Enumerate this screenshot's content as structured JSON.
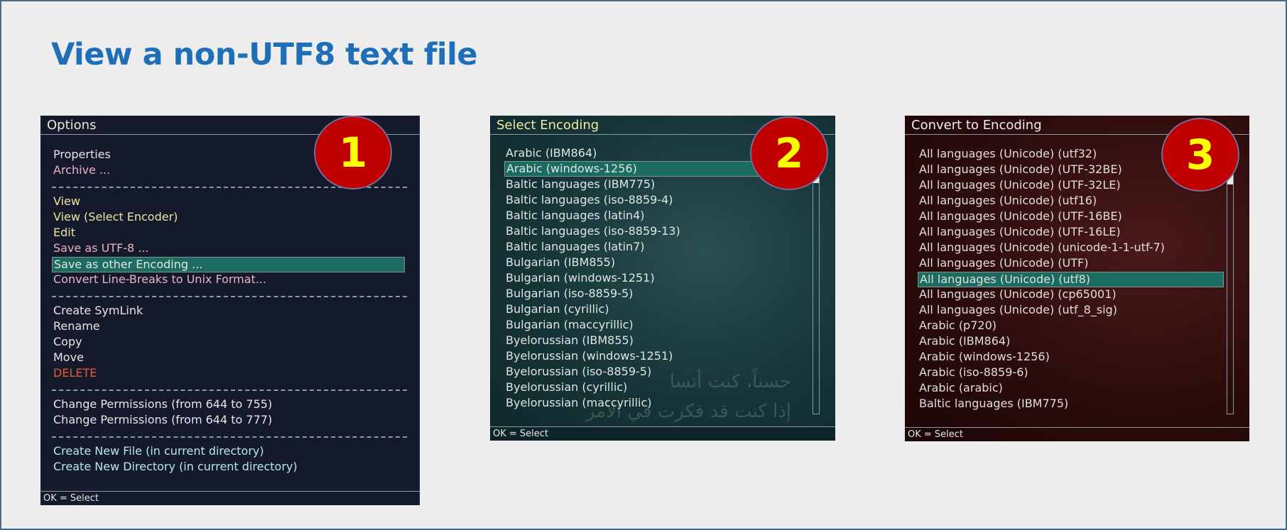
{
  "slide_title": "View a non-UTF8 text file",
  "panel1": {
    "title": "Options",
    "badge": "1",
    "status": "OK = Select",
    "items": [
      {
        "label": "Properties"
      },
      {
        "label": "Archive ..."
      },
      {
        "label": "View"
      },
      {
        "label": "View (Select Encoder)"
      },
      {
        "label": "Edit"
      },
      {
        "label": "Save as UTF-8 ..."
      },
      {
        "label": "Save as other Encoding ..."
      },
      {
        "label": "Convert Line-Breaks to Unix Format..."
      },
      {
        "label": "Create SymLink"
      },
      {
        "label": "Rename"
      },
      {
        "label": "Copy"
      },
      {
        "label": "Move"
      },
      {
        "label": "DELETE"
      },
      {
        "label": "Change Permissions (from 644 to 755)"
      },
      {
        "label": "Change Permissions (from 644 to 777)"
      },
      {
        "label": "Create New File (in current directory)"
      },
      {
        "label": "Create New Directory (in current directory)"
      }
    ],
    "selected_index": 6
  },
  "panel2": {
    "title": "Select Encoding",
    "badge": "2",
    "status": "OK = Select",
    "background_text": [
      "حسناً، كنت أتسا",
      "إذا كنت قد فكرت في الأمر"
    ],
    "items": [
      "Arabic (IBM864)",
      "Arabic (windows-1256)",
      "Baltic languages (IBM775)",
      "Baltic languages (iso-8859-4)",
      "Baltic languages (latin4)",
      "Baltic languages (iso-8859-13)",
      "Baltic languages (latin7)",
      "Bulgarian (IBM855)",
      "Bulgarian (windows-1251)",
      "Bulgarian (iso-8859-5)",
      "Bulgarian (cyrillic)",
      "Bulgarian (maccyrillic)",
      "Byelorussian (IBM855)",
      "Byelorussian (windows-1251)",
      "Byelorussian (iso-8859-5)",
      "Byelorussian (cyrillic)",
      "Byelorussian (maccyrillic)"
    ],
    "selected_index": 1
  },
  "panel3": {
    "title": "Convert to Encoding",
    "badge": "3",
    "status": "OK = Select",
    "items": [
      "All languages (Unicode) (utf32)",
      "All languages (Unicode) (UTF-32BE)",
      "All languages (Unicode) (UTF-32LE)",
      "All languages (Unicode) (utf16)",
      "All languages (Unicode) (UTF-16BE)",
      "All languages (Unicode) (UTF-16LE)",
      "All languages (Unicode) (unicode-1-1-utf-7)",
      "All languages (Unicode) (UTF)",
      "All languages (Unicode) (utf8)",
      "All languages (Unicode) (cp65001)",
      "All languages (Unicode) (utf_8_sig)",
      "Arabic (p720)",
      "Arabic (IBM864)",
      "Arabic (windows-1256)",
      "Arabic (iso-8859-6)",
      "Arabic (arabic)",
      "Baltic languages (IBM775)"
    ],
    "selected_index": 8
  },
  "colors": {
    "title_blue": "#1f6fb8",
    "badge_red": "#c00000",
    "badge_yellow": "#ffff00",
    "selection_teal": "#1c6b60",
    "selected_green_text": "#3cf03c",
    "delete_red": "#e55a3a"
  }
}
